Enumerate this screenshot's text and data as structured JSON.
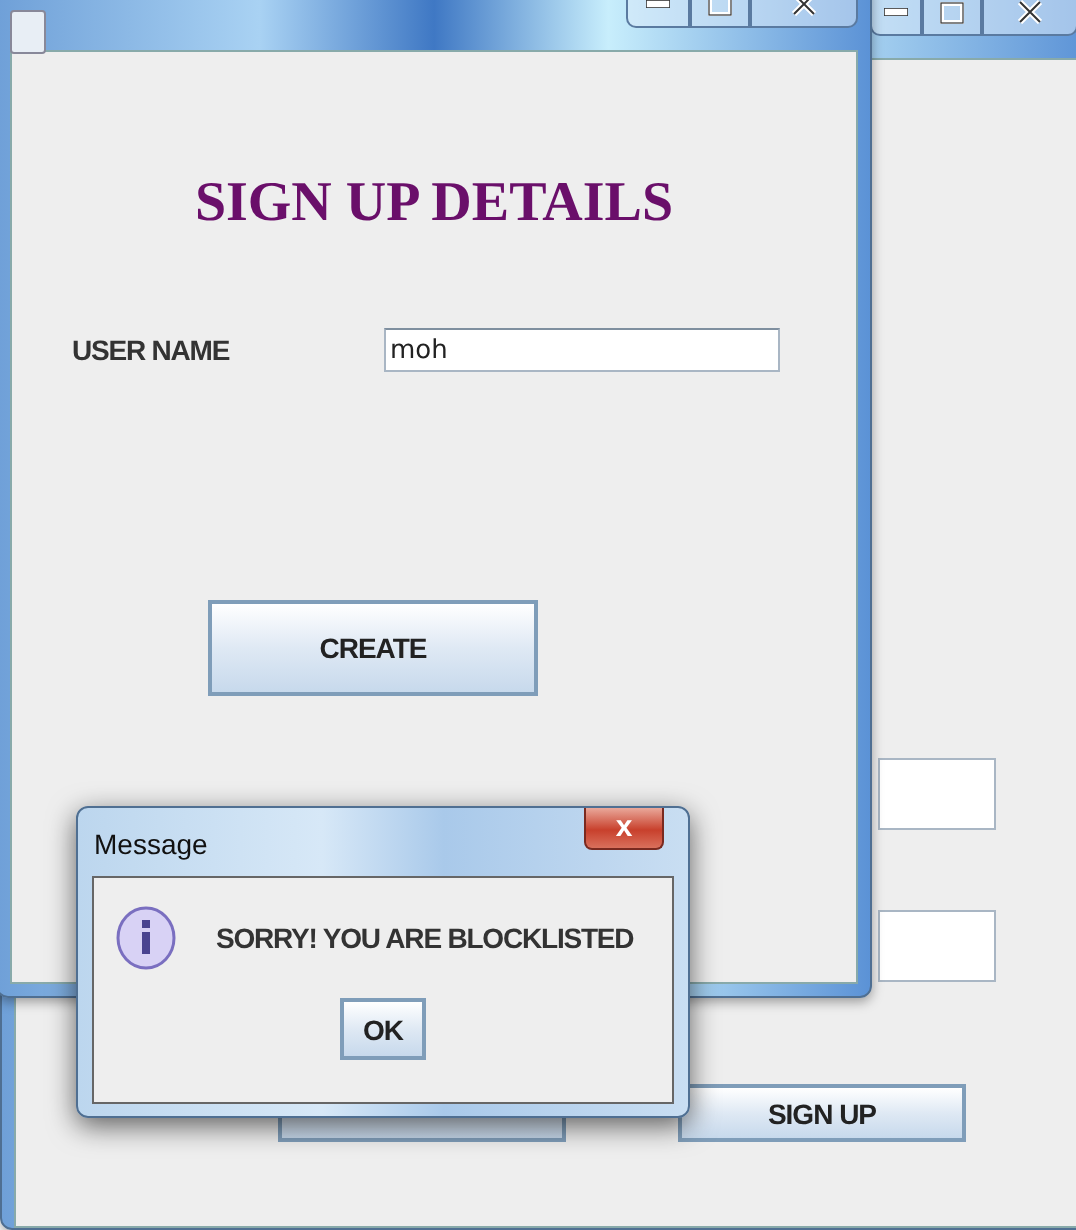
{
  "back_window": {
    "buttons": [
      {
        "kind": "covered"
      },
      {
        "kind": "labeled",
        "label": "SIGN UP"
      }
    ]
  },
  "signup_window": {
    "heading": "SIGN UP DETAILS",
    "user_name": {
      "label": "USER NAME",
      "value": "moh"
    },
    "create_button": "CREATE"
  },
  "message_dialog": {
    "title": "Message",
    "close": "x",
    "message": "SORRY! YOU ARE BLOCKLISTED",
    "ok_button": "OK"
  }
}
